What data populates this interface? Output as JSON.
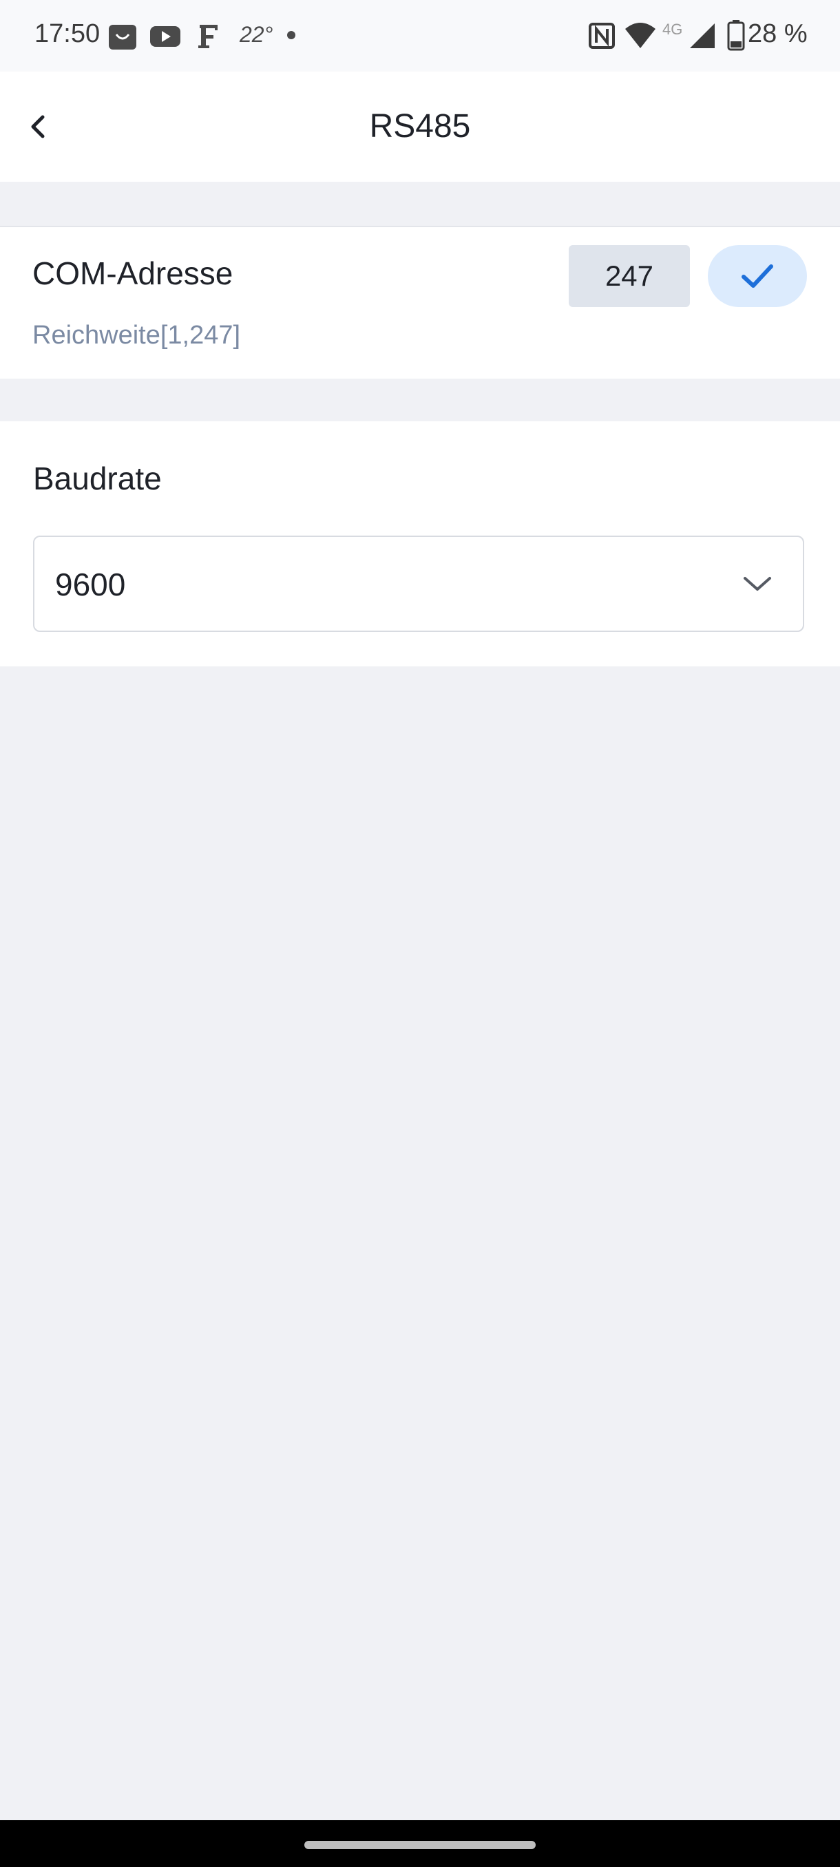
{
  "status_bar": {
    "time": "17:50",
    "weather": "22°",
    "battery": "28 %",
    "network": "4G",
    "icons": [
      "shop-icon",
      "youtube-icon",
      "f-app-icon",
      "weather-icon",
      "dot-icon",
      "nfc-icon",
      "wifi-icon",
      "signal-icon",
      "battery-icon"
    ]
  },
  "header": {
    "title": "RS485",
    "back_icon": "chevron-left-icon"
  },
  "com": {
    "label": "COM-Adresse",
    "value": "247",
    "range": "Reichweite[1,247]",
    "confirm_icon": "checkmark-icon"
  },
  "baud": {
    "label": "Baudrate",
    "selected": "9600",
    "dropdown_icon": "chevron-down-icon"
  },
  "colors": {
    "accent": "#1e6fd9",
    "confirm_bg": "#dcebfd",
    "input_bg": "#dfe4ec",
    "page_bg": "#f0f1f5",
    "hint_text": "#7b8aa3"
  }
}
